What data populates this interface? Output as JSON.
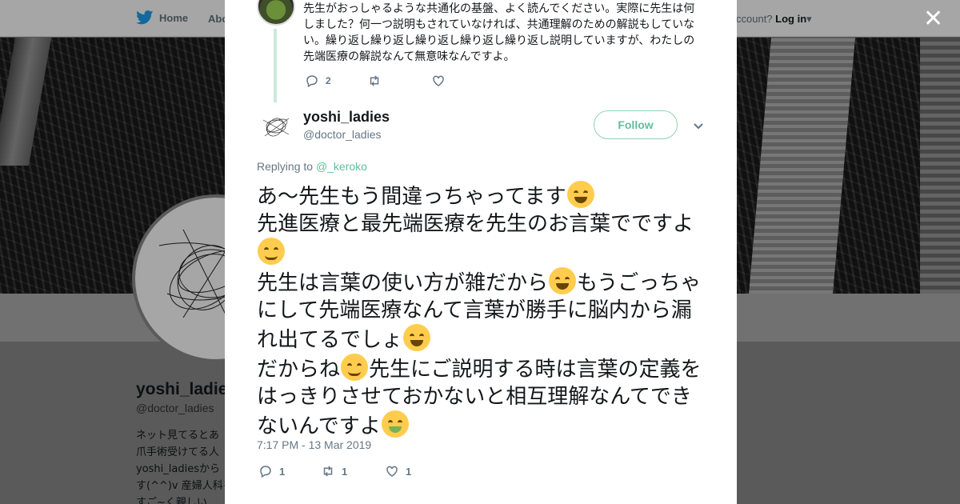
{
  "background": {
    "nav_home": "Home",
    "nav_about": "Abo",
    "account_prompt": "ccount?",
    "login": "Log in",
    "profile_name": "yoshi_ladies",
    "profile_handle": "@doctor_ladies",
    "bio_lines": [
      "ネット見てるとあ",
      "爪手術受けてる人",
      "yoshi_ladiesから",
      "す(^^)v 産婦人科を",
      "すご~く親しい"
    ]
  },
  "parent_tweet": {
    "text": "先生がおっしゃるような共通化の基盤、よく読んでください。実際に先生は何しました？何一つ説明もされていなければ、共通理解のための解説もしていない。繰り返し繰り返し繰り返し繰り返し繰り返し説明していますが、わたしの先端医療の解説なんて無意味なんですよ。",
    "replies": "2",
    "retweets": "",
    "likes": ""
  },
  "tweet": {
    "author_name": "yoshi_ladies",
    "author_handle": "@doctor_ladies",
    "follow_label": "Follow",
    "replying_prefix": "Replying to",
    "replying_to": "@_keroko",
    "lines": [
      {
        "text": "あ～先生もう間違っちゃってます",
        "emoji": "joy-emoji"
      },
      {
        "text": "先進医療と最先端医療を先生のお言葉でですよ",
        "emoji": "blush-emoji"
      },
      {
        "text": "先生は言葉の使い方が雑だから",
        "emoji": "laughing-emoji"
      },
      {
        "text": "もうごっちゃにして先端医療なんて言葉が勝手に脳内から漏れ出てるでしょ",
        "emoji": "grin-emoji"
      },
      {
        "text": "だからね",
        "emoji": "relieved-emoji"
      },
      {
        "text": "先生にご説明する時は言葉の定義をはっきりさせておかないと相互理解なんてできないんですよ",
        "emoji": "money-mouth-emoji"
      }
    ],
    "timestamp": "7:17 PM - 13 Mar 2019",
    "replies": "1",
    "retweets": "1",
    "likes": "1"
  },
  "colors": {
    "accent": "#5fbf9a",
    "twitter_blue": "#1da1f2",
    "text": "#14171a",
    "muted": "#657786"
  }
}
